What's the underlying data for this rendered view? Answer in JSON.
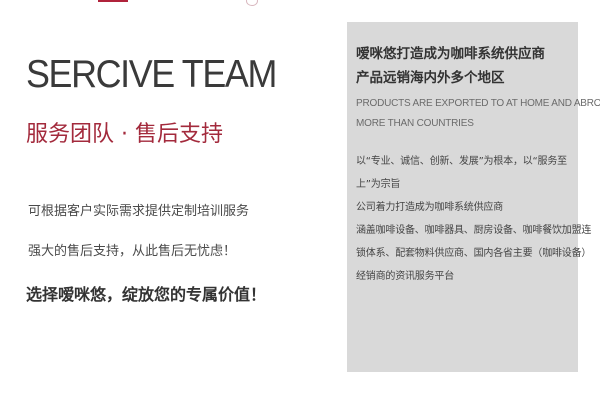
{
  "left": {
    "title": "SERCIVE TEAM",
    "subtitle": "服务团队 · 售后支持",
    "line1": "可根据客户实际需求提供定制培训服务",
    "line2": "强大的售后支持，从此售后无忧虑！",
    "line3": "选择嗳咪悠，绽放您的专属价值！"
  },
  "panel": {
    "heading1": "嗳咪悠打造成为咖啡系统供应商",
    "heading2": "产品远销海内外多个地区",
    "english1": "PRODUCTS ARE EXPORTED TO AT HOME AND ABROAD",
    "english2": "MORE THAN COUNTRIES",
    "lines": [
      "以“专业、诚信、创新、发展”为根本，以“服务至",
      "上”为宗旨",
      "公司着力打造成为咖啡系统供应商",
      "涵盖咖啡设备、咖啡器具、厨房设备、咖啡餐饮加盟连",
      "锁体系、配套物料供应商、国内各省主要（咖啡设备）",
      "经销商的资讯服务平台"
    ]
  },
  "colors": {
    "accent": "#a32a3c",
    "panel_bg": "#d9d9d9"
  }
}
